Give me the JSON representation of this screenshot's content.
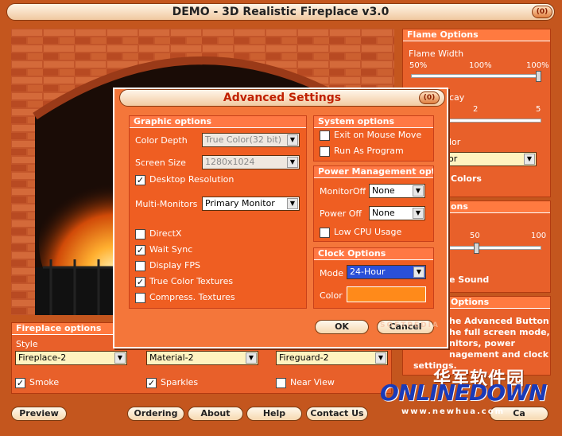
{
  "window": {
    "title": "DEMO - 3D Realistic Fireplace v3.0",
    "close_glyph": "(0)"
  },
  "flame_options": {
    "header": "Flame Options",
    "flame_width_label": "Flame Width",
    "ticks": [
      "50%",
      "100%",
      "100%"
    ],
    "flame_width_value": 1.0,
    "decay_label_partial": "cay",
    "decay_ticks": [
      "2",
      "5"
    ],
    "color_label_partial": "lor",
    "color_select_partial": "or",
    "colors_partial": "Colors"
  },
  "sound_panel": {
    "header_partial": "ons",
    "ticks": [
      "50",
      "100"
    ],
    "sound_partial": "e Sound"
  },
  "help_panel": {
    "header_partial": "Options",
    "line1": "he Advanced Button",
    "line2": "he full screen mode,",
    "line3": "nitors, power",
    "line4": "nagement and clock",
    "line5": "settings."
  },
  "fireplace_options": {
    "header": "Fireplace options",
    "style_label": "Style",
    "style_select": "Fireplace-2",
    "material_select": "Material-2",
    "fireguard_select": "Fireguard-2",
    "smoke_label": "Smoke",
    "smoke_checked": true,
    "sparkles_label": "Sparkles",
    "sparkles_checked": true,
    "near_view_label": "Near View",
    "near_view_checked": false
  },
  "bottom_buttons": {
    "preview": "Preview",
    "ordering": "Ordering",
    "about": "About",
    "help": "Help",
    "contact": "Contact Us",
    "exit_partial": "Ca"
  },
  "advanced": {
    "title": "Advanced Settings",
    "close_glyph": "(0)",
    "graphic": {
      "header": "Graphic options",
      "color_depth_label": "Color Depth",
      "color_depth_value": "True Color(32 bit)",
      "screen_size_label": "Screen Size",
      "screen_size_value": "1280x1024",
      "desktop_resolution_label": "Desktop Resolution",
      "desktop_resolution_checked": true,
      "multi_monitors_label": "Multi-Monitors",
      "multi_monitors_value": "Primary Monitor",
      "directx_label": "DirectX",
      "directx_checked": false,
      "wait_sync_label": "Wait Sync",
      "wait_sync_checked": true,
      "display_fps_label": "Display FPS",
      "display_fps_checked": false,
      "true_color_textures_label": "True Color Textures",
      "true_color_textures_checked": true,
      "compress_textures_label": "Compress. Textures",
      "compress_textures_checked": false
    },
    "system": {
      "header": "System options",
      "exit_on_mouse_label": "Exit on Mouse Move",
      "exit_on_mouse_checked": false,
      "run_as_program_label": "Run As Program",
      "run_as_program_checked": false
    },
    "power": {
      "header": "Power Management option",
      "monitor_off_label": "MonitorOff",
      "monitor_off_value": "None",
      "power_off_label": "Power Off",
      "power_off_value": "None",
      "low_cpu_label": "Low CPU Usage",
      "low_cpu_checked": false
    },
    "clock": {
      "header": "Clock Options",
      "mode_label": "Mode",
      "mode_value": "24-Hour",
      "color_label": "Color",
      "color_swatch": "#ff8a1a"
    },
    "ok": "OK",
    "cancel": "Cancel"
  },
  "watermark": {
    "chinese": "华军软件园",
    "brand": "ONLINEDOWN",
    "url": "www.newhua.com",
    "softpedia": "SOFTPEDIA"
  },
  "colors": {
    "background": "#c4561e",
    "panel": "#e8602a",
    "dialog": "#f4763a",
    "title_text": "#c02000"
  }
}
